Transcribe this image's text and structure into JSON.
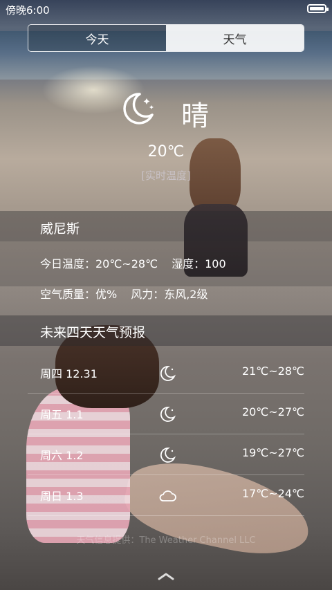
{
  "status_bar": {
    "time": "傍晚6:00",
    "battery_icon": "battery-icon"
  },
  "tabs": [
    {
      "label": "今天",
      "active": true
    },
    {
      "label": "天气",
      "active": false
    }
  ],
  "current": {
    "icon": "moon-icon",
    "condition": "晴",
    "temperature": "20℃",
    "note": "[实时温度]"
  },
  "city": "威尼斯",
  "details": {
    "temp_range": "今日温度：20℃~28℃",
    "humidity": "湿度：100",
    "air_quality": "空气质量：优%",
    "wind": "风力：东风,2级"
  },
  "forecast": {
    "title": "未来四天天气预报",
    "days": [
      {
        "day": "周四 12.31",
        "icon": "moon-icon",
        "range": "21℃~28℃"
      },
      {
        "day": "周五 1.1",
        "icon": "moon-icon",
        "range": "20℃~27℃"
      },
      {
        "day": "周六 1.2",
        "icon": "moon-icon",
        "range": "19℃~27℃"
      },
      {
        "day": "周日 1.3",
        "icon": "cloud-icon",
        "range": "17℃~24℃"
      }
    ]
  },
  "watermark": "天气信息提供：The Weather Channel LLC",
  "bottom_handle": "chevron-up-icon",
  "colors": {
    "tab_inactive_bg": "#ffffff",
    "note_text": "#c8c1c5"
  }
}
